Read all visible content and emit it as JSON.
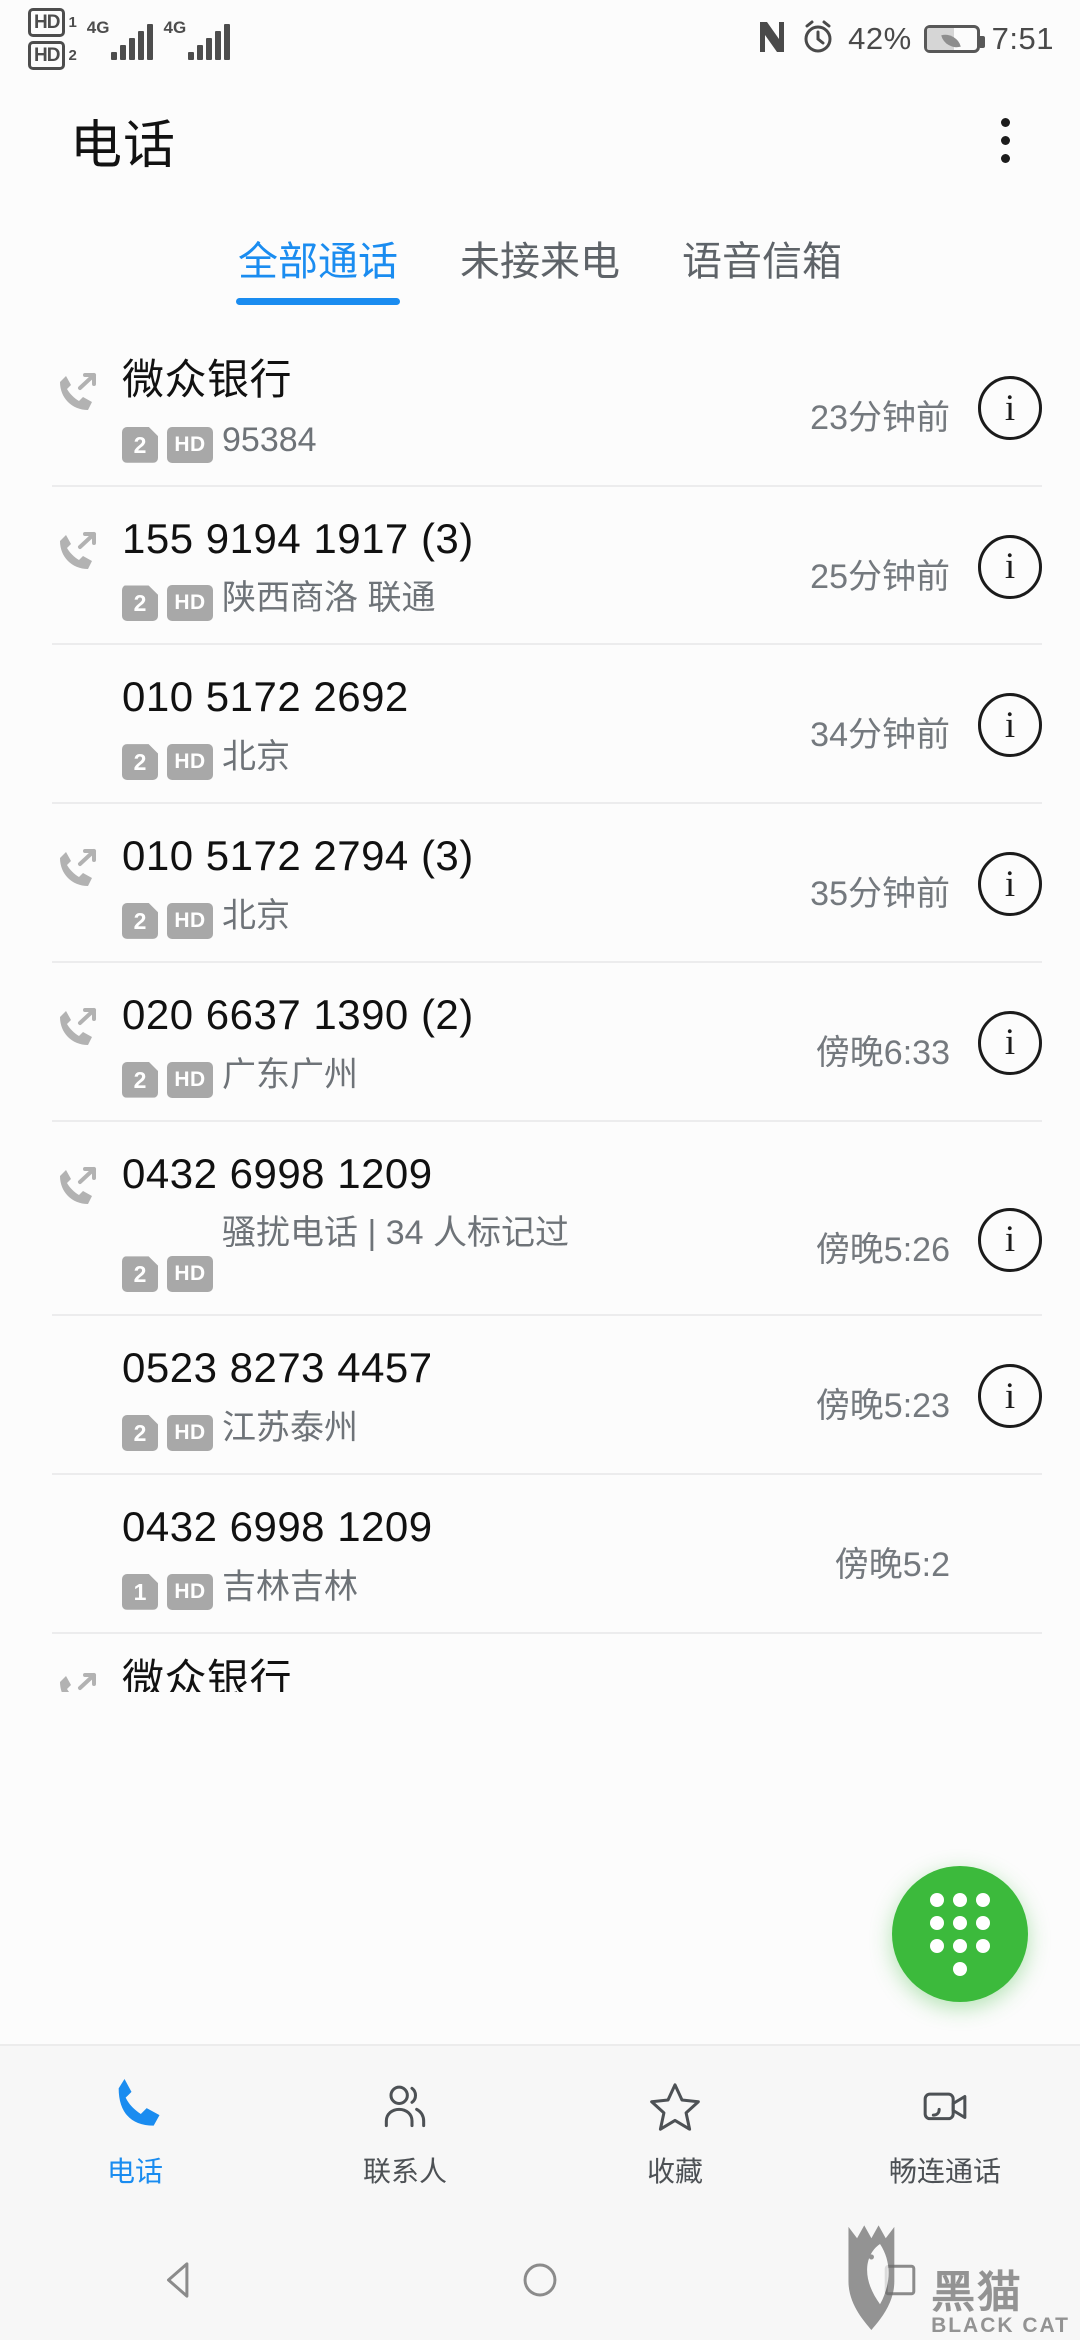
{
  "status_bar": {
    "hd1_label": "HD",
    "hd1_sim": "1",
    "hd2_label": "HD",
    "hd2_sim": "2",
    "net1": "4G",
    "net2": "4G",
    "nfc_icon": "nfc-icon",
    "alarm_icon": "alarm-icon",
    "battery_percent": "42%",
    "battery_icon": "battery-saver-icon",
    "time": "7:51"
  },
  "appbar": {
    "title": "电话",
    "overflow_icon": "more-vertical-icon"
  },
  "tabs": [
    {
      "label": "全部通话",
      "active": true
    },
    {
      "label": "未接来电",
      "active": false
    },
    {
      "label": "语音信箱",
      "active": false
    }
  ],
  "calls": [
    {
      "name": "微众银行",
      "call_type": "outgoing",
      "sim": "2",
      "hd": "HD",
      "subtitle": "95384",
      "time": "23分钟前",
      "info_icon": "info-icon"
    },
    {
      "name": "155 9194 1917 (3)",
      "call_type": "outgoing",
      "sim": "2",
      "hd": "HD",
      "subtitle": "陕西商洛 联通",
      "time": "25分钟前",
      "info_icon": "info-icon"
    },
    {
      "name": "010 5172 2692",
      "call_type": "none",
      "sim": "2",
      "hd": "HD",
      "subtitle": "北京",
      "time": "34分钟前",
      "info_icon": "info-icon"
    },
    {
      "name": "010 5172 2794 (3)",
      "call_type": "outgoing",
      "sim": "2",
      "hd": "HD",
      "subtitle": "北京",
      "time": "35分钟前",
      "info_icon": "info-icon"
    },
    {
      "name": "020 6637 1390 (2)",
      "call_type": "outgoing",
      "sim": "2",
      "hd": "HD",
      "subtitle": "广东广州",
      "time": "傍晚6:33",
      "info_icon": "info-icon"
    },
    {
      "name": "0432 6998 1209",
      "call_type": "outgoing",
      "sim": "2",
      "hd": "HD",
      "subtitle": "骚扰电话 | 34 人标记过",
      "time": "傍晚5:26",
      "info_icon": "info-icon"
    },
    {
      "name": "0523 8273 4457",
      "call_type": "none",
      "sim": "2",
      "hd": "HD",
      "subtitle": "江苏泰州",
      "time": "傍晚5:23",
      "info_icon": "info-icon"
    },
    {
      "name": "0432 6998 1209",
      "call_type": "none",
      "sim": "1",
      "hd": "HD",
      "subtitle": "吉林吉林",
      "time": "傍晚5:2",
      "info_icon": "info-icon"
    },
    {
      "name": "微众银行",
      "call_type": "outgoing",
      "sim": "",
      "hd": "",
      "subtitle": "",
      "time": "",
      "info_icon": "info-icon"
    }
  ],
  "fab": {
    "name": "dialpad-fab",
    "icon": "dialpad-icon",
    "color": "#3cba3c"
  },
  "bottom_nav": [
    {
      "label": "电话",
      "icon": "phone-icon",
      "active": true
    },
    {
      "label": "联系人",
      "icon": "contacts-icon",
      "active": false
    },
    {
      "label": "收藏",
      "icon": "star-icon",
      "active": false
    },
    {
      "label": "畅连通话",
      "icon": "video-call-icon",
      "active": false
    }
  ],
  "system_nav": {
    "back_icon": "back-triangle-icon",
    "home_icon": "home-circle-icon",
    "recents_icon": "recents-square-icon"
  },
  "watermark": {
    "logo_icon": "black-cat-logo-icon",
    "cn": "黑猫",
    "en": "BLACK CAT"
  },
  "colors": {
    "accent_blue": "#1a8cf0",
    "fab_green": "#3cba3c",
    "text_primary": "#111111",
    "text_secondary": "#6e7378"
  }
}
